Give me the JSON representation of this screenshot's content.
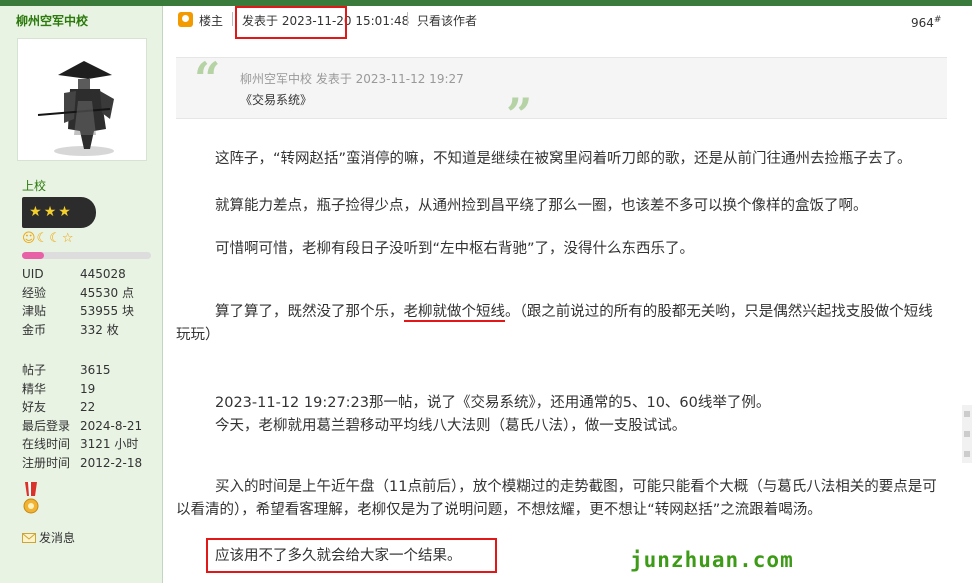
{
  "user": {
    "name": "柳州空军中校",
    "rank": "上校",
    "stars": "★★★",
    "medal_icons": "☺☾☾☆",
    "level_progress": 0.17,
    "stats_top": [
      {
        "k": "UID",
        "v": "445028"
      },
      {
        "k": "经验",
        "v": "45530 点"
      },
      {
        "k": "津贴",
        "v": "53955 块"
      },
      {
        "k": "金币",
        "v": "332 枚"
      }
    ],
    "stats_bottom": [
      {
        "k": "帖子",
        "v": "3615"
      },
      {
        "k": "精华",
        "v": "19"
      },
      {
        "k": "好友",
        "v": "22"
      },
      {
        "k": "最后登录",
        "v": "2024-8-21"
      },
      {
        "k": "在线时间",
        "v": "3121 小时"
      },
      {
        "k": "注册时间",
        "v": "2012-2-18"
      }
    ],
    "send_message": "发消息"
  },
  "post": {
    "role": "楼主",
    "posted_at": "发表于 2023-11-20 15:01:48",
    "only_author": "只看该作者",
    "floor": "964",
    "floor_sup": "#",
    "quote_meta": "柳州空军中校 发表于 2023-11-12 19:27",
    "quote_text": "《交易系统》",
    "paragraphs": [
      "这阵子，“转网赵括”蛮消停的嘛，不知道是继续在被窝里闷着听刀郎的歌，还是从前门往通州去捡瓶子去了。",
      "就算能力差点，瓶子捡得少点，从通州捡到昌平绕了那么一圈，也该差不多可以换个像样的盒饭了啊。",
      "可惜啊可惜，老柳有段日子没听到“左中枢右背驰”了，没得什么东西乐了。",
      "2023-11-12 19:27:23那一帖，说了《交易系统》，还用通常的5、10、60线举了例。",
      "今天，老柳就用葛兰碧移动平均线八大法则（葛氏八法），做一支股试试。",
      "买入的时间是上午近午盘（11点前后），放个模糊过的走势截图，可能只能看个大概（与葛氏八法相关的要点是可以看清的），希望看客理解，老柳仅是为了说明问题，不想炫耀，更不想让“转网赵括”之流跟着喝汤。",
      "应该用不了多久就会给大家一个结果。"
    ],
    "p4_before": "算了算了，既然没了那个乐，",
    "p4_underlined": "老柳就做个短线",
    "p4_after": "。（跟之前说过的所有的股都无关哟，只是偶然兴起找支股做个短线玩玩）"
  },
  "watermark": "junzhuan.com",
  "colors": {
    "accent_green": "#2b7a0b",
    "highlight_red": "#e21818",
    "watermark_green": "#3d9b17"
  }
}
